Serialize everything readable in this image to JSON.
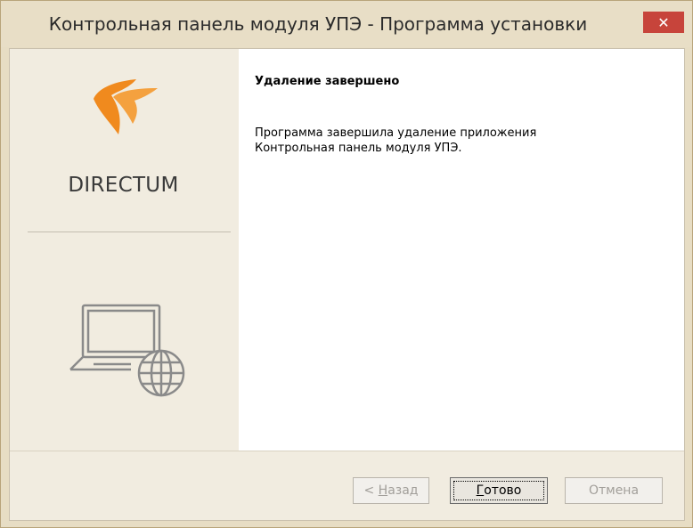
{
  "window": {
    "title": "Контрольная панель модуля УПЭ - Программа установки",
    "close_glyph": "✕"
  },
  "side_panel": {
    "logo_text": "DIRECTUM",
    "logo_icon": "directum-logo-icon",
    "illustration_icon": "laptop-globe-icon"
  },
  "content": {
    "heading": "Удаление завершено",
    "message_line1": "Программа завершила удаление приложения",
    "message_line2": "Контрольная панель модуля УПЭ."
  },
  "buttons": {
    "back": {
      "prefix": "< ",
      "accel": "Н",
      "rest": "азад",
      "enabled": false
    },
    "done": {
      "accel": "Г",
      "rest": "отово",
      "enabled": true
    },
    "cancel": {
      "label": "Отмена",
      "enabled": false
    }
  },
  "colors": {
    "close_button": "#c7443b",
    "logo_orange": "#f08a1e",
    "title_bar": "#e8dec6",
    "side_panel": "#f1ece0"
  }
}
